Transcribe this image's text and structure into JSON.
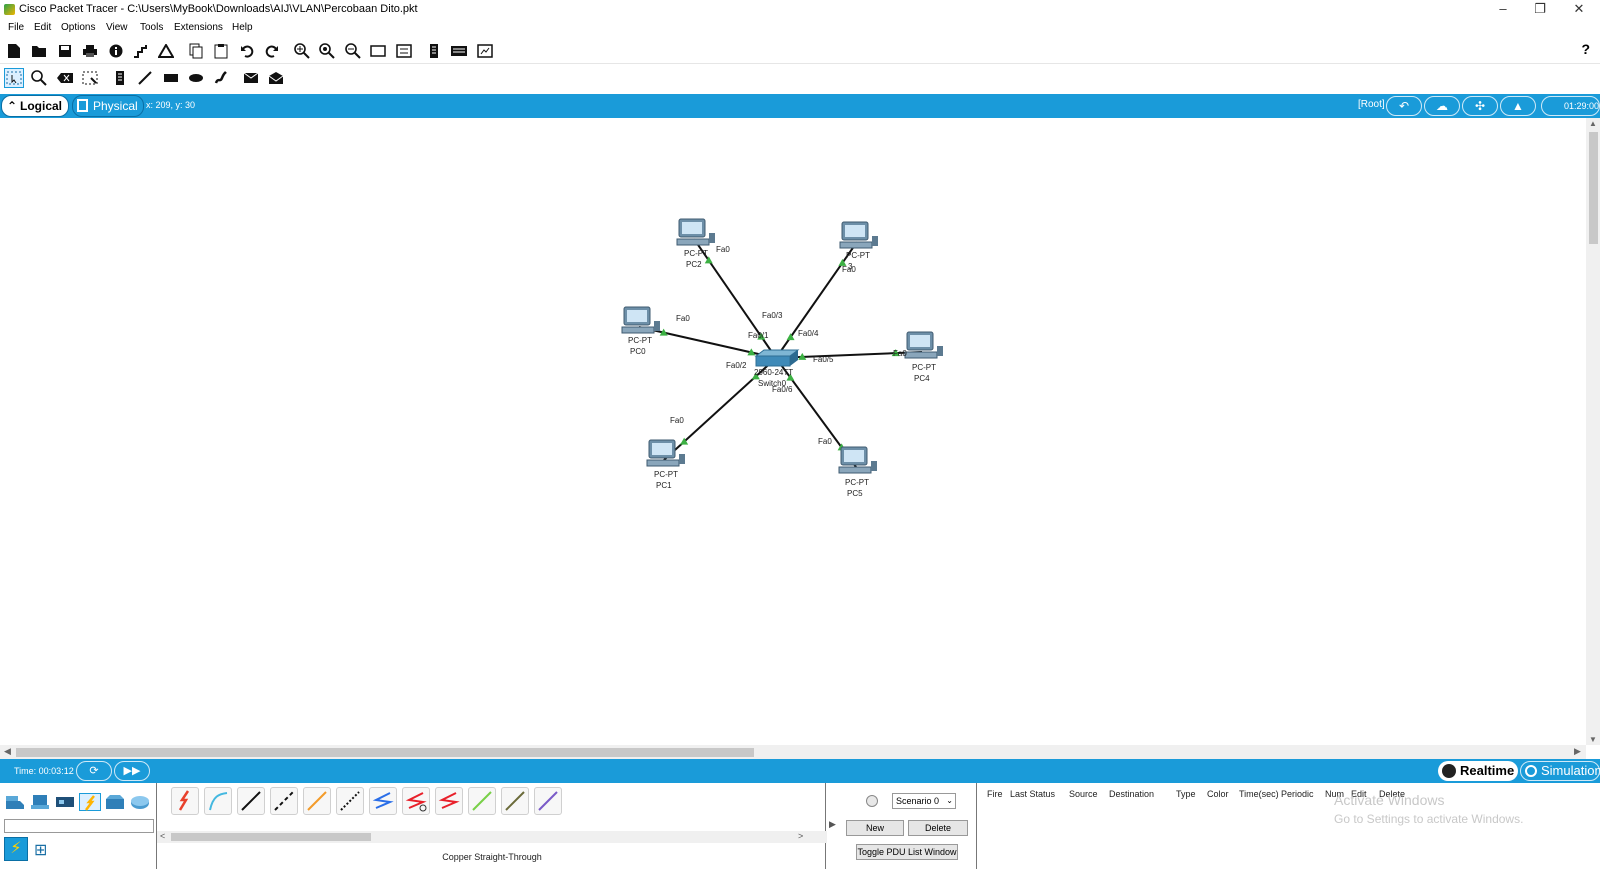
{
  "window": {
    "title": "Cisco Packet Tracer - C:\\Users\\MyBook\\Downloads\\AIJ\\VLAN\\Percobaan Dito.pkt",
    "minimize": "–",
    "restore": "❐",
    "close": "✕"
  },
  "menu": [
    "File",
    "Edit",
    "Options",
    "View",
    "Tools",
    "Extensions",
    "Help"
  ],
  "toolbar": {
    "main_icons": [
      "new-icon",
      "open-icon",
      "save-icon",
      "print-icon",
      "info-icon",
      "network-wizard-icon",
      "activity-wizard-icon",
      "copy-icon",
      "paste-icon",
      "undo-icon",
      "redo-icon",
      "zoom-in-icon",
      "zoom-reset-icon",
      "zoom-out-icon",
      "drawing-palette-icon",
      "custom-devices-icon",
      "viewport-icon",
      "cluster-icon",
      "ipc-icon"
    ],
    "help": "?",
    "common_tools": [
      "select-icon",
      "inspect-icon",
      "delete-icon",
      "resize-icon",
      "note-icon",
      "line-icon",
      "rectangle-icon",
      "ellipse-icon",
      "freeform-icon",
      "simple-pdu-icon",
      "complex-pdu-icon"
    ]
  },
  "workspace_bar": {
    "logical_tab": "Logical",
    "physical_tab": "Physical",
    "coordinates": "x: 209, y: 30",
    "root": "[Root]",
    "clock": "01:29:00",
    "accent_color": "#1a9bd9"
  },
  "topology": {
    "switch": {
      "type": "2960-24TT",
      "name": "Switch0"
    },
    "pcs": [
      {
        "type": "PC-PT",
        "name": "PC0",
        "pc_port": "Fa0",
        "switch_port": "Fa0/1"
      },
      {
        "type": "PC-PT",
        "name": "PC1",
        "pc_port": "Fa0",
        "switch_port": "Fa0/2"
      },
      {
        "type": "PC-PT",
        "name": "PC2",
        "pc_port": "Fa0",
        "switch_port": "Fa0/3"
      },
      {
        "type": "PC-PT",
        "name": "3",
        "pc_port": "Fa0",
        "switch_port": "Fa0/4"
      },
      {
        "type": "PC-PT",
        "name": "PC4",
        "pc_port": "Fa0",
        "switch_port": "Fa0/5"
      },
      {
        "type": "PC-PT",
        "name": "PC5",
        "pc_port": "Fa0",
        "switch_port": "Fa0/6"
      }
    ],
    "link_status_color": "#3cb043"
  },
  "status": {
    "time": "Time: 00:03:12",
    "realtime": "Realtime",
    "simulation": "Simulation"
  },
  "device_panel": {
    "categories": [
      "network-devices-icon",
      "end-devices-icon",
      "components-icon",
      "connections-icon",
      "misc-icon",
      "multiuser-icon"
    ]
  },
  "connections": {
    "cables": [
      {
        "name": "Automatically Choose Connection Type",
        "color": "#e8412c"
      },
      {
        "name": "Console",
        "color": "#44b8e0"
      },
      {
        "name": "Copper Straight-Through",
        "color": "#111111"
      },
      {
        "name": "Copper Cross-Over",
        "color": "#111111"
      },
      {
        "name": "Fiber",
        "color": "#f39b2a"
      },
      {
        "name": "Phone",
        "color": "#111111"
      },
      {
        "name": "Coaxial",
        "color": "#2a6ee8"
      },
      {
        "name": "Serial DCE",
        "color": "#e8202a"
      },
      {
        "name": "Serial DTE",
        "color": "#e8202a"
      },
      {
        "name": "Octal",
        "color": "#78d048"
      },
      {
        "name": "IoT Custom Cable",
        "color": "#6b6b3a"
      },
      {
        "name": "USB",
        "color": "#7a5bc8"
      }
    ],
    "selected_label": "Copper Straight-Through"
  },
  "scenario": {
    "select_value": "Scenario 0",
    "new": "New",
    "delete": "Delete",
    "toggle": "Toggle PDU List Window"
  },
  "pdu_columns": [
    "Fire",
    "Last Status",
    "Source",
    "Destination",
    "Type",
    "Color",
    "Time(sec)",
    "Periodic",
    "Num",
    "Edit",
    "Delete"
  ],
  "watermark": {
    "line1": "Activate Windows",
    "line2": "Go to Settings to activate Windows."
  }
}
